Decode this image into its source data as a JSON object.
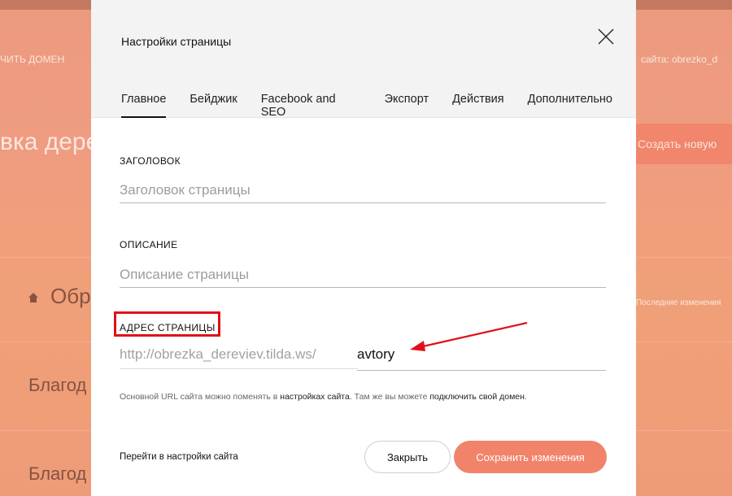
{
  "background": {
    "connect_domain": "ЧИТЬ ДОМЕН",
    "site_address": "сайта: obrezko_d",
    "project_title": "вка дере",
    "create_button": "Создать новую",
    "home_label": "Обр",
    "last_changes": "Последние изменения",
    "row1": "Благод",
    "row2": "Благод"
  },
  "modal": {
    "title": "Настройки страницы",
    "tabs": [
      {
        "label": "Главное",
        "active": true
      },
      {
        "label": "Бейджик"
      },
      {
        "label": "Facebook and SEO"
      },
      {
        "label": "Экспорт"
      },
      {
        "label": "Действия"
      },
      {
        "label": "Дополнительно"
      }
    ],
    "fields": {
      "title_label": "ЗАГОЛОВОК",
      "title_placeholder": "Заголовок страницы",
      "description_label": "ОПИСАНИЕ",
      "description_placeholder": "Описание страницы",
      "address_label": "АДРЕС СТРАНИЦЫ",
      "url_prefix": "http://obrezka_dereviev.tilda.ws/",
      "url_slug": "avtory"
    },
    "hint": {
      "text1": "Основной URL сайта можно поменять в ",
      "link1": "настройках сайта",
      "text2": ". Там же вы можете ",
      "link2": "подключить свой домен",
      "text3": "."
    },
    "footer": {
      "site_settings_link": "Перейти в настройки сайта",
      "close_button": "Закрыть",
      "save_button": "Сохранить изменения"
    }
  },
  "colors": {
    "accent": "#f1836a",
    "highlight": "#e0101a",
    "background": "#ee9b7d"
  }
}
